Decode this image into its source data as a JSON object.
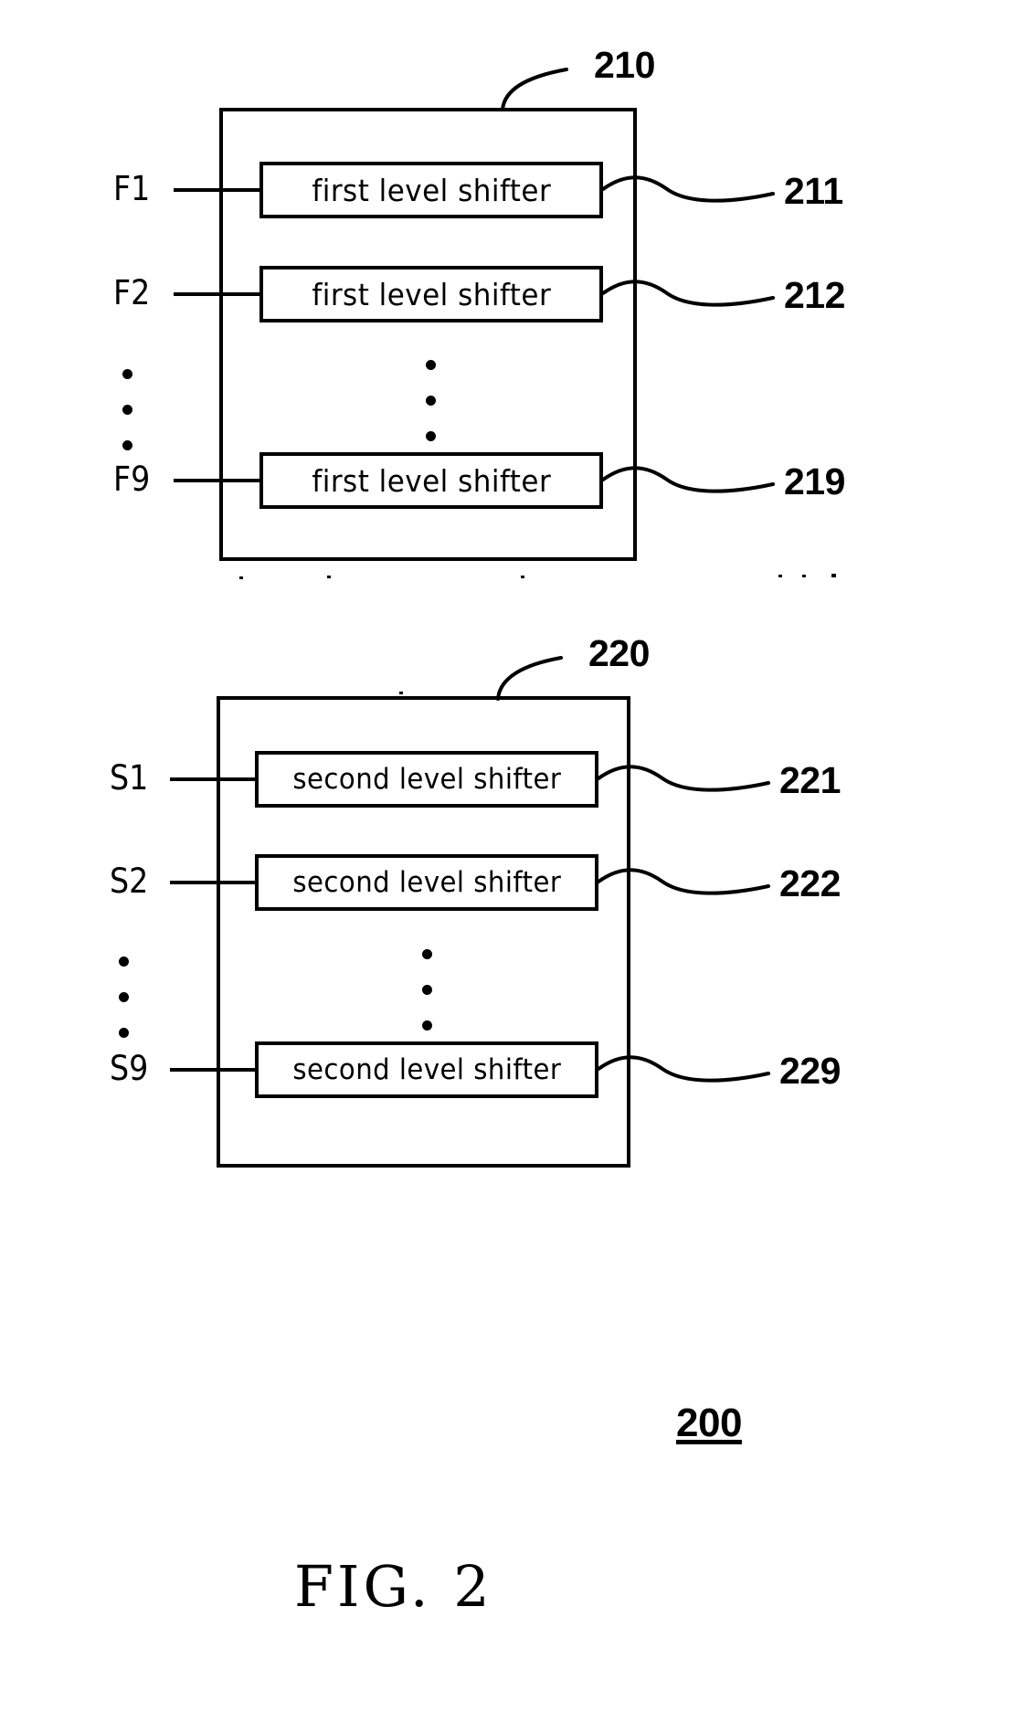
{
  "figure": {
    "caption": "FIG.  2",
    "overall_ref": "200"
  },
  "blocks": [
    {
      "ref": "210",
      "kind": "first-level-shifter-group",
      "rows": [
        {
          "port": "F1",
          "label": "first  level  shifter",
          "ref": "211"
        },
        {
          "port": "F2",
          "label": "first  level  shifter",
          "ref": "212"
        },
        {
          "port": "F9",
          "label": "first  level  shifter",
          "ref": "219"
        }
      ],
      "ellipsis": "⠇"
    },
    {
      "ref": "220",
      "kind": "second-level-shifter-group",
      "rows": [
        {
          "port": "S1",
          "label": "second  level  shifter",
          "ref": "221"
        },
        {
          "port": "S2",
          "label": "second  level  shifter",
          "ref": "222"
        },
        {
          "port": "S9",
          "label": "second  level  shifter",
          "ref": "229"
        }
      ],
      "ellipsis": "⠇"
    }
  ],
  "colors": {
    "stroke": "#000000",
    "background": "#ffffff"
  }
}
